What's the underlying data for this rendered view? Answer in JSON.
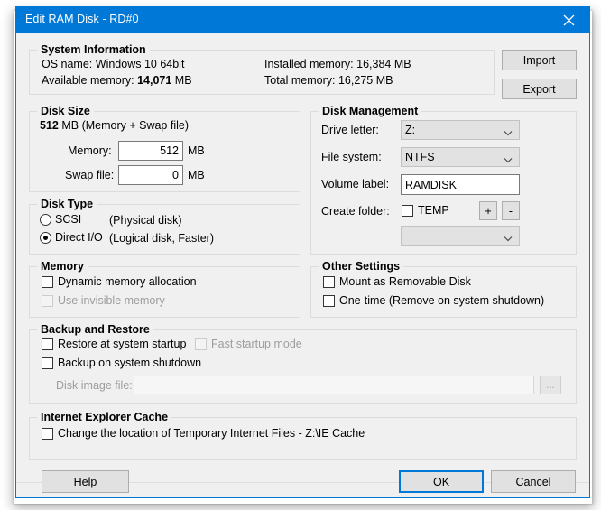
{
  "window": {
    "title": "Edit RAM Disk - RD#0",
    "close_icon": "close-icon",
    "accent_color": "#0078d7",
    "background_color": "#f0f0f0"
  },
  "system_information": {
    "title": "System Information",
    "os_name_label": "OS name:",
    "os_name_value": "Windows 10 64bit",
    "available_memory_label": "Available memory:",
    "available_memory_value": "14,071",
    "available_memory_unit": "MB",
    "installed_memory_label": "Installed memory:",
    "installed_memory_value": "16,384 MB",
    "total_memory_label": "Total memory:",
    "total_memory_value": "16,275 MB",
    "import_label": "Import",
    "export_label": "Export"
  },
  "disk_size": {
    "title": "Disk Size",
    "total_value": "512",
    "total_suffix": "MB (Memory + Swap file)",
    "memory_label": "Memory:",
    "memory_value": "512",
    "memory_unit": "MB",
    "swap_label": "Swap file:",
    "swap_value": "0",
    "swap_unit": "MB"
  },
  "disk_type": {
    "title": "Disk Type",
    "scsi_label": "SCSI",
    "scsi_note": "(Physical disk)",
    "scsi_selected": false,
    "directio_label": "Direct I/O",
    "directio_note": "(Logical disk, Faster)",
    "directio_selected": true
  },
  "memory": {
    "title": "Memory",
    "dynamic_label": "Dynamic memory allocation",
    "dynamic_checked": false,
    "invisible_label": "Use invisible memory",
    "invisible_checked": false,
    "invisible_enabled": false
  },
  "disk_management": {
    "title": "Disk Management",
    "drive_letter_label": "Drive letter:",
    "drive_letter_value": "Z:",
    "file_system_label": "File system:",
    "file_system_value": "NTFS",
    "volume_label_label": "Volume label:",
    "volume_label_value": "RAMDISK",
    "create_folder_label": "Create folder:",
    "create_folder_checkbox_label": "TEMP",
    "create_folder_checked": false,
    "add_button_label": "+",
    "remove_button_label": "-",
    "folder_list_value": ""
  },
  "other_settings": {
    "title": "Other Settings",
    "removable_label": "Mount as Removable Disk",
    "removable_checked": false,
    "onetime_label": "One-time (Remove on system shutdown)",
    "onetime_checked": false
  },
  "backup_restore": {
    "title": "Backup and Restore",
    "restore_label": "Restore at system startup",
    "restore_checked": false,
    "fast_startup_label": "Fast startup mode",
    "fast_startup_checked": false,
    "fast_startup_enabled": false,
    "backup_label": "Backup on system shutdown",
    "backup_checked": false,
    "disk_image_label": "Disk image file:",
    "disk_image_value": "",
    "browse_label": "...",
    "disk_image_enabled": false
  },
  "ie_cache": {
    "title": "Internet Explorer Cache",
    "change_location_label": "Change the location of Temporary Internet Files - Z:\\IE Cache",
    "change_location_checked": false
  },
  "footer": {
    "help_label": "Help",
    "ok_label": "OK",
    "cancel_label": "Cancel"
  }
}
